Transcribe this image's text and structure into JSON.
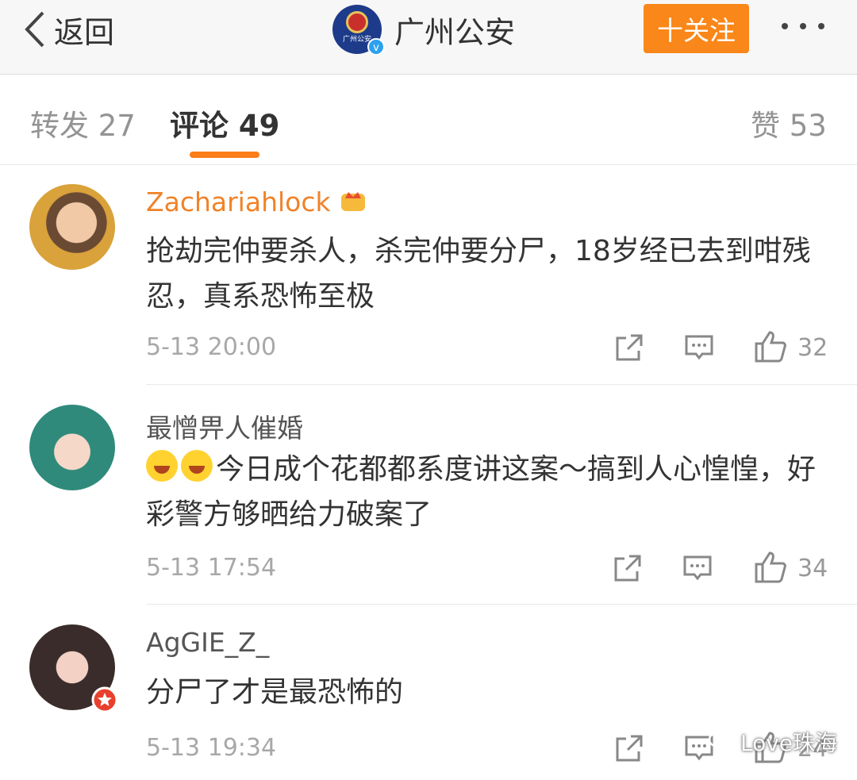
{
  "header": {
    "back_label": "返回",
    "account_name": "广州公安",
    "avatar_text": "广州公安",
    "verified_mark": "v",
    "follow_label": "十关注"
  },
  "tabs": [
    {
      "label": "转发 27",
      "active": false
    },
    {
      "label": "评论 49",
      "active": true
    },
    {
      "label": "赞 53",
      "active": false
    }
  ],
  "comments": [
    {
      "user": "Zachariahlock",
      "vip": true,
      "text": "抢劫完仲要杀人，杀完仲要分尸，18岁经已去到咁残忍，真系恐怖至极",
      "time": "5-13 20:00",
      "likes": "32"
    },
    {
      "user": "最憎畀人催婚",
      "vip": false,
      "emoji_count": 2,
      "text": "今日成个花都都系度讲这案～搞到人心惶惶，好彩警方够晒给力破案了",
      "time": "5-13 17:54",
      "likes": "34"
    },
    {
      "user": "AgGIE_Z_",
      "vip": false,
      "text": "分尸了才是最恐怖的",
      "time": "5-13 19:34",
      "likes": "24"
    }
  ],
  "watermark": "Love珠海",
  "colors": {
    "accent": "#fa8719",
    "vip_name": "#f18228",
    "tab_underline": "#fa7d19"
  },
  "icons": [
    "chevron-left-icon",
    "more-dots-icon",
    "share-icon",
    "comment-icon",
    "like-icon",
    "crown-icon",
    "wechat-icon"
  ]
}
